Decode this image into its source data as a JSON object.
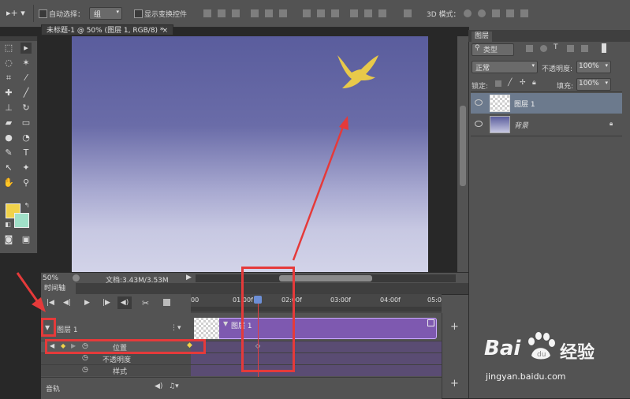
{
  "options_bar": {
    "auto_select_label": "自动选择：",
    "auto_select_value": "组",
    "show_transform_label": "显示变换控件",
    "mode_3d_label": "3D 模式："
  },
  "document": {
    "tab_title": "未标题-1 @ 50% (图层 1, RGB/8) *",
    "tab_close": "×",
    "zoom": "50%",
    "doc_info": "文档:3.43M/3.53M"
  },
  "timeline": {
    "panel_title": "时间轴",
    "ruler_labels": [
      "00",
      "01:00f",
      "02:00f",
      "03:00f",
      "04:00f",
      "05:0"
    ],
    "layer_name": "图层 1",
    "clip_label": "图层 1",
    "properties": [
      "位置",
      "不透明度",
      "样式"
    ],
    "audio_track": "音轨",
    "add_symbol": "+"
  },
  "layers_panel": {
    "tab_title": "图层",
    "filter_kind": "类型",
    "blend_mode": "正常",
    "opacity_label": "不透明度:",
    "opacity_value": "100%",
    "lock_label": "锁定:",
    "fill_label": "填充:",
    "fill_value": "100%",
    "layers": [
      {
        "name": "图层 1",
        "selected": true
      },
      {
        "name": "背景",
        "selected": false
      }
    ]
  },
  "colors": {
    "foreground": "#f1d24a",
    "background": "#a0e0c8",
    "clip": "#7e59b0",
    "annotation": "#e53a3a"
  },
  "watermark": {
    "brand": "Bai",
    "brand2": "经验",
    "url": "jingyan.baidu.com"
  }
}
